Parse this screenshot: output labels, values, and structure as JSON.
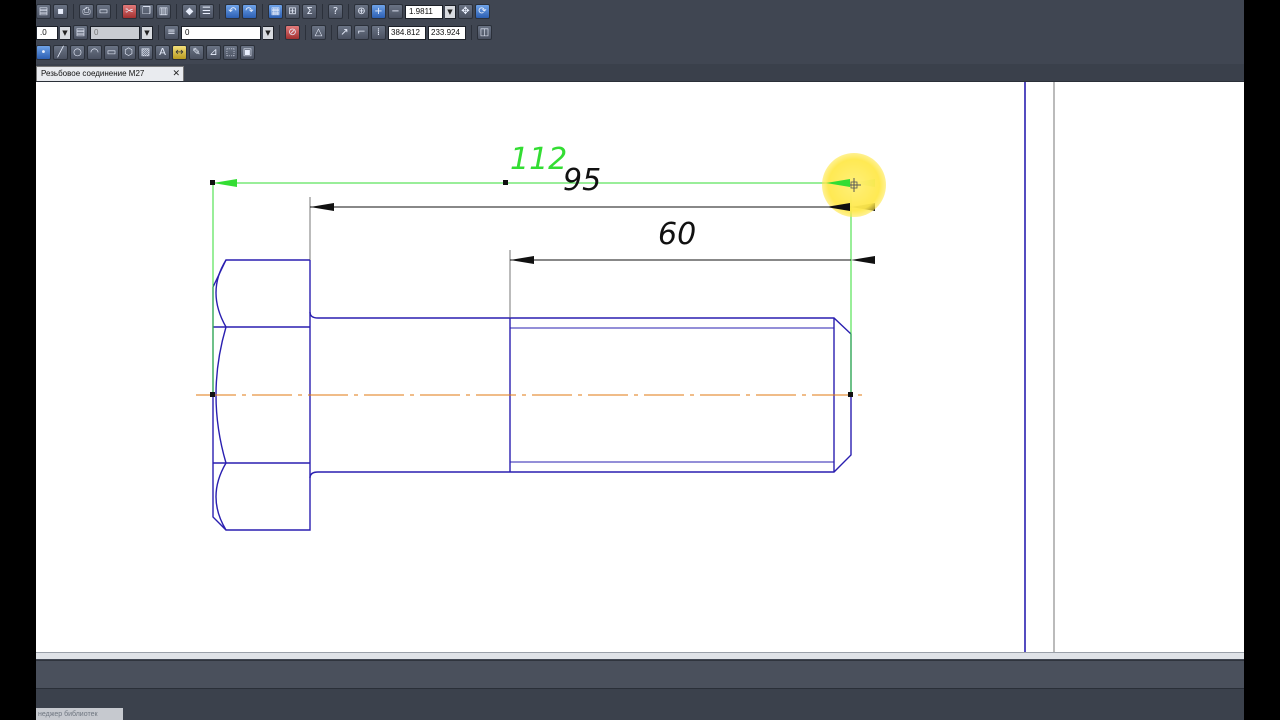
{
  "app": {
    "document_tab": {
      "title": "Резьбовое соединение М27",
      "close_glyph": "✕"
    },
    "bottom_panel_tab": "неджер библиотек"
  },
  "toolbar": {
    "zoom_value": "1.9811",
    "line_width_value": ".0",
    "layer_value": "0",
    "style_value": "0",
    "coord_x": "384.812",
    "coord_y": "233.924"
  },
  "icons": {
    "open": "folder-icon",
    "save": "save-icon",
    "print": "print-icon",
    "preview": "preview-icon",
    "cut": "cut-icon",
    "copy": "copy-icon",
    "paste": "paste-icon",
    "properties": "properties-icon",
    "undo": "undo-icon",
    "redo": "redo-icon",
    "zoom_in": "zoom-in-icon",
    "zoom_out": "zoom-out-icon",
    "pan": "pan-icon",
    "refresh": "refresh-icon",
    "snap": "snap-icon",
    "layers": "layers-icon"
  },
  "drawing": {
    "dimensions": [
      {
        "id": "dim-112",
        "value": "112",
        "color": "#33dd33"
      },
      {
        "id": "dim-95",
        "value": "95",
        "color": "#111111"
      },
      {
        "id": "dim-60",
        "value": "60",
        "color": "#111111"
      }
    ],
    "colors": {
      "outline": "#2a1fb0",
      "axis": "#e07a10",
      "active_dimension": "#33dd33",
      "dimension": "#111111",
      "frame": "#2a1fb0",
      "cursor_highlight": "#ffe84a"
    }
  }
}
